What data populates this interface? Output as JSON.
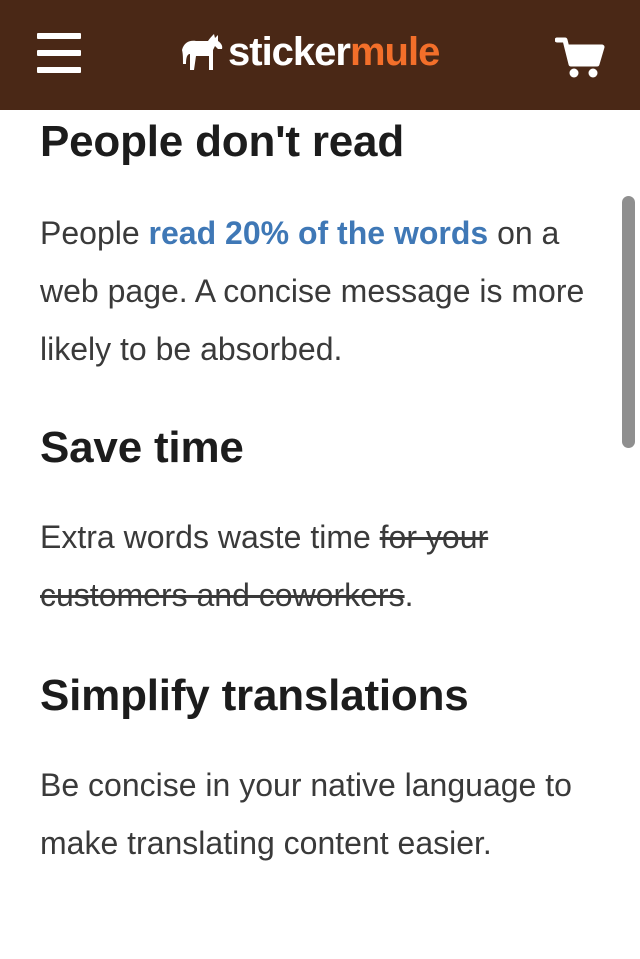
{
  "header": {
    "brand_part1": "sticker",
    "brand_part2": "mule",
    "brand_color": "#4a2816",
    "accent_color": "#f36f2a",
    "menu_icon": "hamburger-menu-icon",
    "logo_icon": "mule-logo-icon",
    "cart_icon": "shopping-cart-icon"
  },
  "sections": [
    {
      "heading": "People don't read",
      "text_before": "People ",
      "link_text": "read 20% of the words",
      "text_after": " on a web page. A concise message is more likely to be absorbed."
    },
    {
      "heading": "Save time",
      "text_before": "Extra words waste time ",
      "struck_text": "for your customers and coworkers",
      "text_after": "."
    },
    {
      "heading": "Simplify translations",
      "text": "Be concise in your native language to make translating content easier."
    }
  ],
  "colors": {
    "link": "#3f78b6",
    "heading": "#1c1c1c",
    "body_text": "#3a3a3a"
  }
}
